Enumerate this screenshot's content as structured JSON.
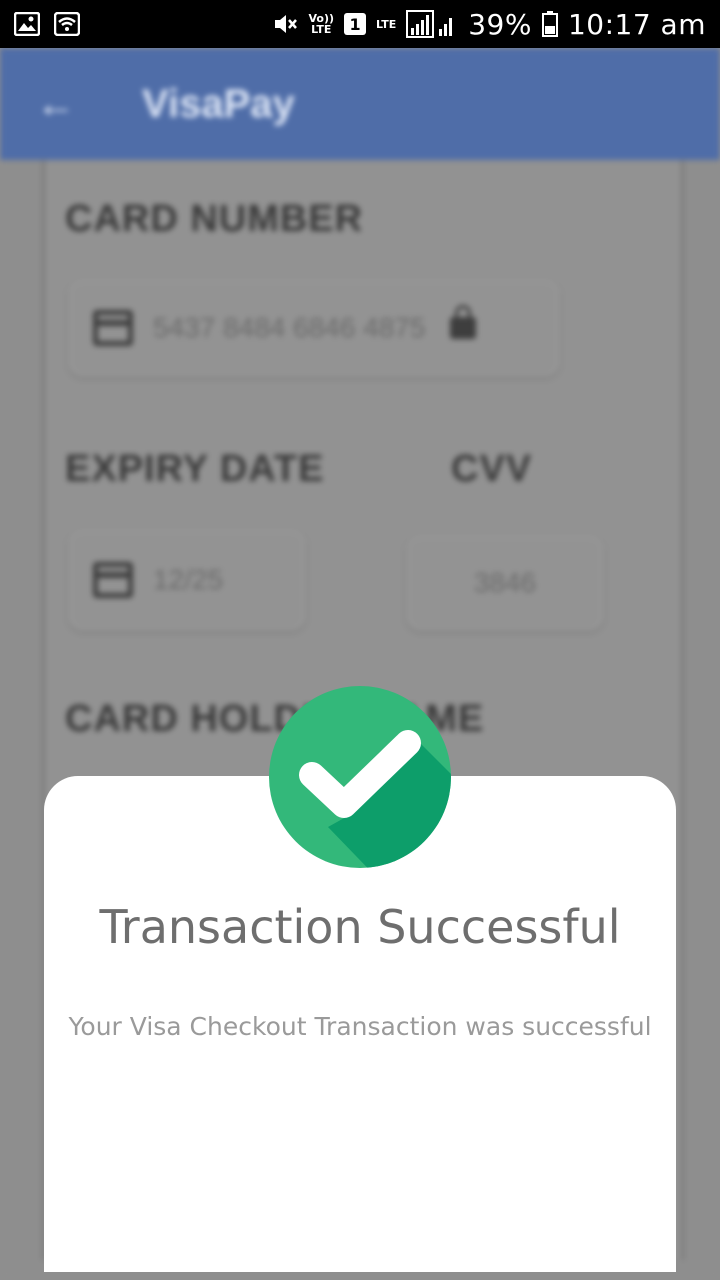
{
  "status_bar": {
    "volte": "Vo))",
    "lte": "LTE",
    "sim": "1",
    "lte2": "LTE",
    "battery": "39%",
    "time": "10:17 am",
    "icons": [
      "image-icon",
      "wifi-icon",
      "mute-icon",
      "signal-icon",
      "battery-icon"
    ]
  },
  "app_bar": {
    "back_icon": "←",
    "title": "VisaPay",
    "color": "#4f6da8"
  },
  "form": {
    "card_number_label": "CARD NUMBER",
    "card_number_value": "5437 8484 6846 4875",
    "expiry_label": "EXPIRY DATE",
    "expiry_value": "12/25",
    "cvv_label": "CVV",
    "cvv_value": "3846",
    "holder_label": "CARD HOLDER NAME"
  },
  "dialog": {
    "title": "Transaction Successful",
    "message": "Your Visa Checkout Transaction was successful",
    "icon": "check-circle-icon",
    "accent": "#33b87a"
  }
}
